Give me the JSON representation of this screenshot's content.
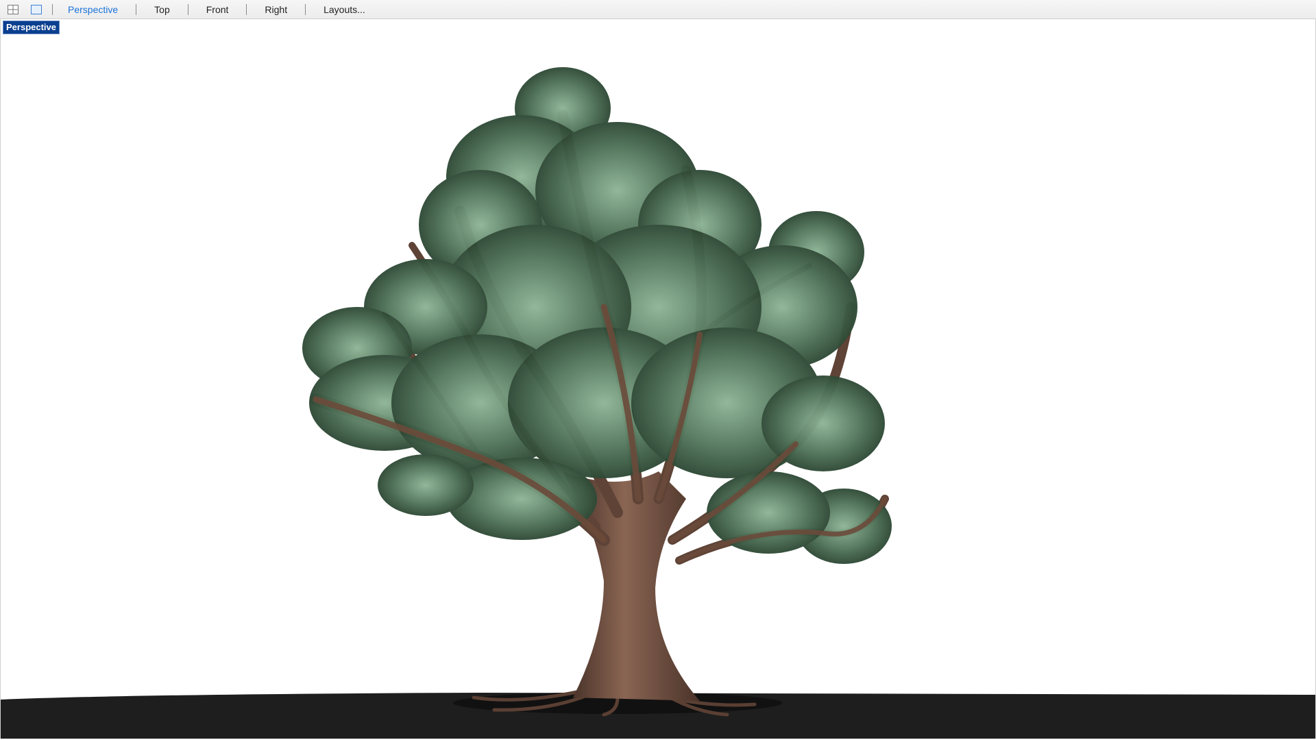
{
  "toolbar": {
    "icons": [
      "four-viewport-layout-icon",
      "single-viewport-layout-icon"
    ],
    "tabs": [
      {
        "id": "perspective",
        "label": "Perspective",
        "active": true
      },
      {
        "id": "top",
        "label": "Top",
        "active": false
      },
      {
        "id": "front",
        "label": "Front",
        "active": false
      },
      {
        "id": "right",
        "label": "Right",
        "active": false
      },
      {
        "id": "layouts",
        "label": "Layouts...",
        "active": false
      }
    ]
  },
  "viewport": {
    "label": "Perspective",
    "label_color": "#0b3f8f",
    "background": "#ffffff",
    "ground_color": "#1e1e1e"
  },
  "colors": {
    "active_tab": "#1a73d9",
    "trunk": "#6b4a3a",
    "foliage_dark": "#3d5b45",
    "foliage_light": "#7fa487"
  }
}
